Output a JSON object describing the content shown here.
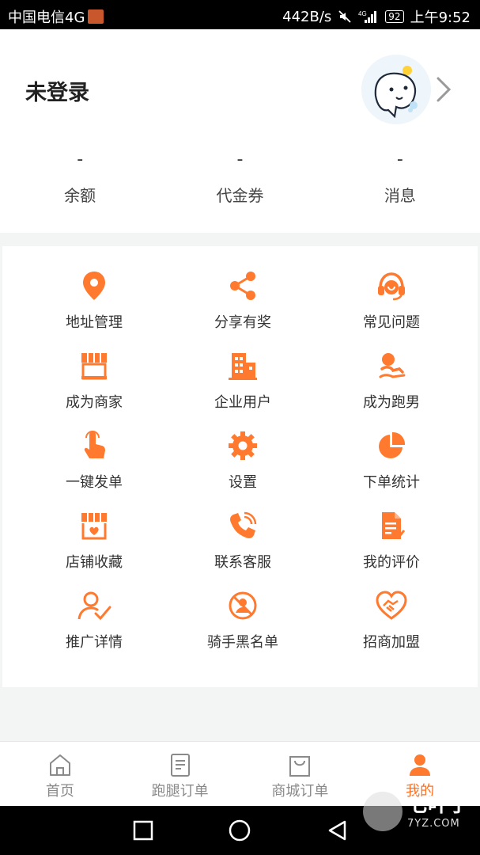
{
  "status_bar": {
    "carrier": "中国电信4G",
    "speed": "442B/s",
    "network": "4G",
    "battery": "92",
    "time": "上午9:52"
  },
  "profile": {
    "login_status": "未登录",
    "stats": [
      {
        "value": "-",
        "label": "余额"
      },
      {
        "value": "-",
        "label": "代金券"
      },
      {
        "value": "-",
        "label": "消息"
      }
    ]
  },
  "menu": {
    "items": [
      {
        "label": "地址管理",
        "icon": "location-pin-icon"
      },
      {
        "label": "分享有奖",
        "icon": "share-icon"
      },
      {
        "label": "常见问题",
        "icon": "headset-icon"
      },
      {
        "label": "成为商家",
        "icon": "storefront-icon"
      },
      {
        "label": "企业用户",
        "icon": "building-icon"
      },
      {
        "label": "成为跑男",
        "icon": "runner-icon"
      },
      {
        "label": "一键发单",
        "icon": "tap-finger-icon"
      },
      {
        "label": "设置",
        "icon": "gear-icon"
      },
      {
        "label": "下单统计",
        "icon": "pie-chart-icon"
      },
      {
        "label": "店铺收藏",
        "icon": "shop-heart-icon"
      },
      {
        "label": "联系客服",
        "icon": "phone-icon"
      },
      {
        "label": "我的评价",
        "icon": "document-edit-icon"
      },
      {
        "label": "推广详情",
        "icon": "user-check-icon"
      },
      {
        "label": "骑手黑名单",
        "icon": "blocked-user-icon"
      },
      {
        "label": "招商加盟",
        "icon": "handshake-heart-icon"
      }
    ]
  },
  "bottom_nav": {
    "items": [
      {
        "label": "首页",
        "icon": "home-icon"
      },
      {
        "label": "跑腿订单",
        "icon": "order-list-icon"
      },
      {
        "label": "商城订单",
        "icon": "shopping-bag-icon"
      },
      {
        "label": "我的",
        "icon": "user-icon"
      }
    ],
    "active_index": 3
  },
  "watermark": {
    "name": "七叶子",
    "domain": "7YZ.COM"
  },
  "colors": {
    "accent": "#ff7a2e",
    "active_tab": "#ff6f1f",
    "inactive_tab": "#8a8a8a"
  }
}
